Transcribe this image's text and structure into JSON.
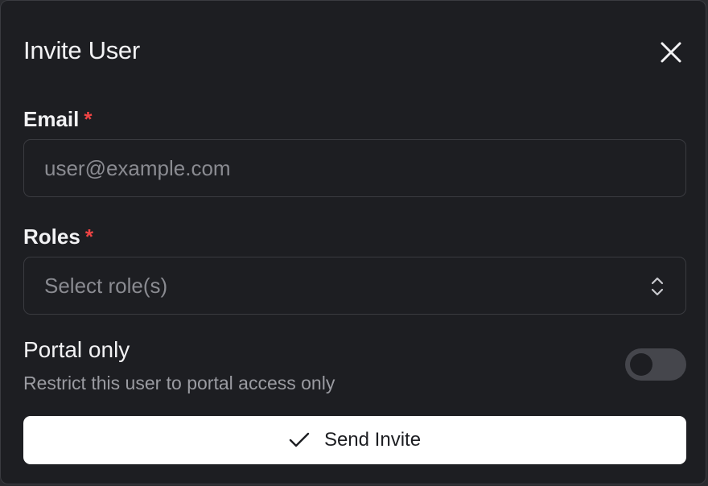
{
  "dialog": {
    "title": "Invite User",
    "close_icon": "close-icon"
  },
  "email": {
    "label": "Email",
    "required_mark": "*",
    "placeholder": "user@example.com",
    "value": ""
  },
  "roles": {
    "label": "Roles",
    "required_mark": "*",
    "placeholder": "Select role(s)",
    "icon": "chevron-up-down-icon"
  },
  "portal_only": {
    "title": "Portal only",
    "description": "Restrict this user to portal access only",
    "enabled": false
  },
  "submit": {
    "label": "Send Invite",
    "icon": "check-icon"
  },
  "colors": {
    "background": "#1d1e22",
    "border": "#3a3b40",
    "required": "#ef4444",
    "button_bg": "#ffffff",
    "toggle_track": "#45464c"
  }
}
